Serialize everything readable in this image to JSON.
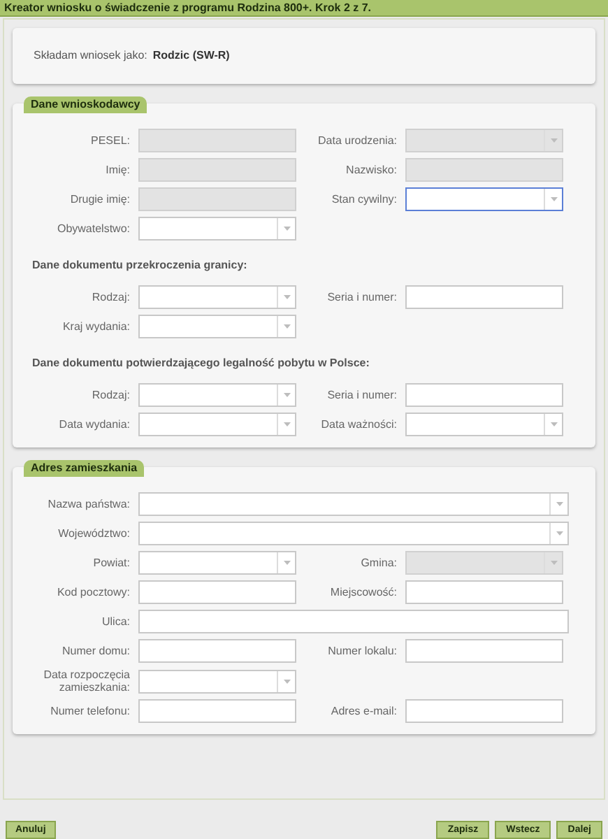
{
  "title": "Kreator wniosku o świadczenie z programu Rodzina 800+. Krok 2 z 7.",
  "applicant": {
    "label": "Składam wniosek jako:",
    "value": "Rodzic (SW-R)"
  },
  "sections": [
    {
      "title": "Dane wnioskodawcy",
      "groups": [
        {
          "rows": [
            [
              {
                "label": "PESEL:",
                "kind": "text",
                "disabled": true,
                "focused": false
              },
              {
                "label": "Data urodzenia:",
                "kind": "select",
                "disabled": true,
                "focused": false
              }
            ],
            [
              {
                "label": "Imię:",
                "kind": "text",
                "disabled": true,
                "focused": false
              },
              {
                "label": "Nazwisko:",
                "kind": "text",
                "disabled": true,
                "focused": false
              }
            ],
            [
              {
                "label": "Drugie imię:",
                "kind": "text",
                "disabled": true,
                "focused": false
              },
              {
                "label": "Stan cywilny:",
                "kind": "select",
                "disabled": false,
                "focused": true
              }
            ],
            [
              {
                "label": "Obywatelstwo:",
                "kind": "select",
                "disabled": false,
                "focused": false
              }
            ]
          ]
        },
        {
          "heading": "Dane dokumentu przekroczenia granicy:",
          "rows": [
            [
              {
                "label": "Rodzaj:",
                "kind": "select",
                "disabled": false,
                "focused": false
              },
              {
                "label": "Seria i numer:",
                "kind": "text",
                "disabled": false,
                "focused": false
              }
            ],
            [
              {
                "label": "Kraj wydania:",
                "kind": "select",
                "disabled": false,
                "focused": false
              }
            ]
          ]
        },
        {
          "heading": "Dane dokumentu potwierdzającego legalność pobytu w Polsce:",
          "rows": [
            [
              {
                "label": "Rodzaj:",
                "kind": "select",
                "disabled": false,
                "focused": false
              },
              {
                "label": "Seria i numer:",
                "kind": "text",
                "disabled": false,
                "focused": false
              }
            ],
            [
              {
                "label": "Data wydania:",
                "kind": "select",
                "disabled": false,
                "focused": false
              },
              {
                "label": "Data ważności:",
                "kind": "select",
                "disabled": false,
                "focused": false
              }
            ]
          ]
        }
      ]
    },
    {
      "title": "Adres zamieszkania",
      "groups": [
        {
          "rows": [
            [
              {
                "label": "Nazwa państwa:",
                "kind": "select",
                "disabled": false,
                "focused": false,
                "wide": true
              }
            ],
            [
              {
                "label": "Województwo:",
                "kind": "select",
                "disabled": false,
                "focused": false,
                "wide": true
              }
            ],
            [
              {
                "label": "Powiat:",
                "kind": "select",
                "disabled": false,
                "focused": false
              },
              {
                "label": "Gmina:",
                "kind": "select",
                "disabled": true,
                "focused": false
              }
            ],
            [
              {
                "label": "Kod pocztowy:",
                "kind": "text",
                "disabled": false,
                "focused": false
              },
              {
                "label": "Miejscowość:",
                "kind": "text",
                "disabled": false,
                "focused": false
              }
            ],
            [
              {
                "label": "Ulica:",
                "kind": "text",
                "disabled": false,
                "focused": false,
                "wide": true
              }
            ],
            [
              {
                "label": "Numer domu:",
                "kind": "text",
                "disabled": false,
                "focused": false
              },
              {
                "label": "Numer lokalu:",
                "kind": "text",
                "disabled": false,
                "focused": false
              }
            ],
            [
              {
                "label": "Data rozpoczęcia zamieszkania:",
                "kind": "select",
                "disabled": false,
                "focused": false
              }
            ],
            [
              {
                "label": "Numer telefonu:",
                "kind": "text",
                "disabled": false,
                "focused": false
              },
              {
                "label": "Adres e-mail:",
                "kind": "text",
                "disabled": false,
                "focused": false
              }
            ]
          ]
        }
      ]
    }
  ],
  "buttons_left": [
    "Anuluj"
  ],
  "buttons_right": [
    "Zapisz",
    "Wstecz",
    "Dalej"
  ]
}
